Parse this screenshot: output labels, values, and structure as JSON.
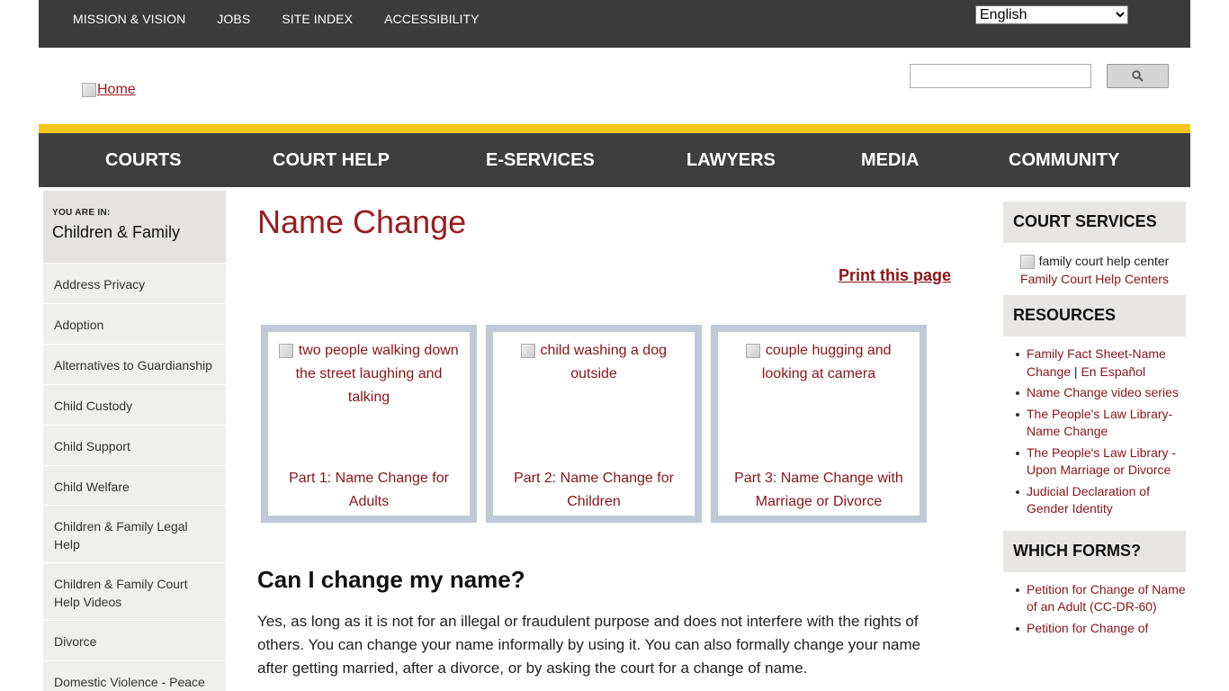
{
  "topbar": {
    "links": [
      "MISSION & VISION",
      "JOBS",
      "SITE INDEX",
      "ACCESSIBILITY"
    ],
    "language": "English"
  },
  "header": {
    "logo_alt": "Home",
    "search_placeholder": ""
  },
  "nav": {
    "items": [
      "COURTS",
      "COURT HELP",
      "E-SERVICES",
      "LAWYERS",
      "MEDIA",
      "COMMUNITY"
    ]
  },
  "sidebar": {
    "you_are_in_label": "YOU ARE IN:",
    "section": "Children & Family",
    "items": [
      "Address Privacy",
      "Adoption",
      "Alternatives to Guardianship",
      "Child Custody",
      "Child Support",
      "Child Welfare",
      "Children & Family Legal Help",
      "Children & Family Court Help Videos",
      "Divorce",
      "Domestic Violence - Peace"
    ]
  },
  "main": {
    "title": "Name Change",
    "print_label": "Print this page",
    "cards": [
      {
        "alt": "two people walking down the street laughing and talking",
        "caption": "Part 1: Name Change for Adults"
      },
      {
        "alt": "child washing a dog outside",
        "caption": "Part 2: Name Change for Children"
      },
      {
        "alt": "couple hugging and looking at camera",
        "caption": "Part 3: Name Change with Marriage or Divorce"
      }
    ],
    "question": "Can I change my name?",
    "answer": "Yes, as long as it is not for an illegal or fraudulent purpose and does not interfere with the rights of others. You can change your name informally by using it. You can also formally change your name after getting married, after a divorce, or by asking the court for a change of name."
  },
  "right": {
    "services_heading": "COURT SERVICES",
    "services_img_alt": "family court help center",
    "services_link": "Family Court Help Centers",
    "resources_heading": "RESOURCES",
    "resources": {
      "r1_a": "Family Fact Sheet-Name Change",
      "r1_sep": " | ",
      "r1_b": "En Español",
      "r2": "Name Change video series",
      "r3": "The People's Law Library-Name Change",
      "r4": "The People's Law Library - Upon Marriage or Divorce",
      "r5": "Judicial Declaration of Gender Identity"
    },
    "forms_heading": "WHICH FORMS?",
    "forms": [
      "Petition for Change of Name of an Adult (CC-DR-60)",
      "Petition for Change of"
    ]
  }
}
